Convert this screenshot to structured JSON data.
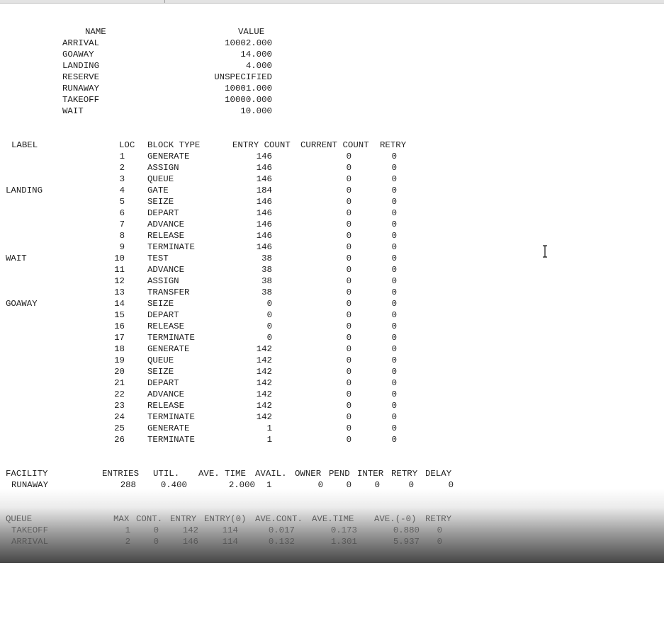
{
  "symbols": {
    "header": {
      "name": "NAME",
      "value": "VALUE"
    },
    "rows": [
      {
        "name": "ARRIVAL",
        "value": "10002.000"
      },
      {
        "name": "GOAWAY",
        "value": "14.000"
      },
      {
        "name": "LANDING",
        "value": "4.000"
      },
      {
        "name": "RESERVE",
        "value": "UNSPECIFIED"
      },
      {
        "name": "RUNAWAY",
        "value": "10001.000"
      },
      {
        "name": "TAKEOFF",
        "value": "10000.000"
      },
      {
        "name": "WAIT",
        "value": "10.000"
      }
    ]
  },
  "blocks": {
    "header": {
      "label": "LABEL",
      "loc": "LOC",
      "type": "BLOCK TYPE",
      "entry": "ENTRY COUNT",
      "current": "CURRENT COUNT",
      "retry": "RETRY"
    },
    "rows": [
      {
        "label": "",
        "loc": "1",
        "type": "GENERATE",
        "entry": "146",
        "current": "0",
        "retry": "0"
      },
      {
        "label": "",
        "loc": "2",
        "type": "ASSIGN",
        "entry": "146",
        "current": "0",
        "retry": "0"
      },
      {
        "label": "",
        "loc": "3",
        "type": "QUEUE",
        "entry": "146",
        "current": "0",
        "retry": "0"
      },
      {
        "label": "LANDING",
        "loc": "4",
        "type": "GATE",
        "entry": "184",
        "current": "0",
        "retry": "0"
      },
      {
        "label": "",
        "loc": "5",
        "type": "SEIZE",
        "entry": "146",
        "current": "0",
        "retry": "0"
      },
      {
        "label": "",
        "loc": "6",
        "type": "DEPART",
        "entry": "146",
        "current": "0",
        "retry": "0"
      },
      {
        "label": "",
        "loc": "7",
        "type": "ADVANCE",
        "entry": "146",
        "current": "0",
        "retry": "0"
      },
      {
        "label": "",
        "loc": "8",
        "type": "RELEASE",
        "entry": "146",
        "current": "0",
        "retry": "0"
      },
      {
        "label": "",
        "loc": "9",
        "type": "TERMINATE",
        "entry": "146",
        "current": "0",
        "retry": "0"
      },
      {
        "label": "WAIT",
        "loc": "10",
        "type": "TEST",
        "entry": "38",
        "current": "0",
        "retry": "0"
      },
      {
        "label": "",
        "loc": "11",
        "type": "ADVANCE",
        "entry": "38",
        "current": "0",
        "retry": "0"
      },
      {
        "label": "",
        "loc": "12",
        "type": "ASSIGN",
        "entry": "38",
        "current": "0",
        "retry": "0"
      },
      {
        "label": "",
        "loc": "13",
        "type": "TRANSFER",
        "entry": "38",
        "current": "0",
        "retry": "0"
      },
      {
        "label": "GOAWAY",
        "loc": "14",
        "type": "SEIZE",
        "entry": "0",
        "current": "0",
        "retry": "0"
      },
      {
        "label": "",
        "loc": "15",
        "type": "DEPART",
        "entry": "0",
        "current": "0",
        "retry": "0"
      },
      {
        "label": "",
        "loc": "16",
        "type": "RELEASE",
        "entry": "0",
        "current": "0",
        "retry": "0"
      },
      {
        "label": "",
        "loc": "17",
        "type": "TERMINATE",
        "entry": "0",
        "current": "0",
        "retry": "0"
      },
      {
        "label": "",
        "loc": "18",
        "type": "GENERATE",
        "entry": "142",
        "current": "0",
        "retry": "0"
      },
      {
        "label": "",
        "loc": "19",
        "type": "QUEUE",
        "entry": "142",
        "current": "0",
        "retry": "0"
      },
      {
        "label": "",
        "loc": "20",
        "type": "SEIZE",
        "entry": "142",
        "current": "0",
        "retry": "0"
      },
      {
        "label": "",
        "loc": "21",
        "type": "DEPART",
        "entry": "142",
        "current": "0",
        "retry": "0"
      },
      {
        "label": "",
        "loc": "22",
        "type": "ADVANCE",
        "entry": "142",
        "current": "0",
        "retry": "0"
      },
      {
        "label": "",
        "loc": "23",
        "type": "RELEASE",
        "entry": "142",
        "current": "0",
        "retry": "0"
      },
      {
        "label": "",
        "loc": "24",
        "type": "TERMINATE",
        "entry": "142",
        "current": "0",
        "retry": "0"
      },
      {
        "label": "",
        "loc": "25",
        "type": "GENERATE",
        "entry": "1",
        "current": "0",
        "retry": "0"
      },
      {
        "label": "",
        "loc": "26",
        "type": "TERMINATE",
        "entry": "1",
        "current": "0",
        "retry": "0"
      }
    ]
  },
  "facility": {
    "header": {
      "facility": "FACILITY",
      "entries": "ENTRIES",
      "util": "UTIL.",
      "avetime": "AVE. TIME",
      "avail": "AVAIL.",
      "owner": "OWNER",
      "pend": "PEND",
      "inter": "INTER",
      "retry": "RETRY",
      "delay": "DELAY"
    },
    "rows": [
      {
        "facility": "RUNAWAY",
        "entries": "288",
        "util": "0.400",
        "avetime": "2.000",
        "avail": "1",
        "owner": "0",
        "pend": "0",
        "inter": "0",
        "retry": "0",
        "delay": "0"
      }
    ]
  },
  "queue": {
    "header": {
      "queue": "QUEUE",
      "max": "MAX",
      "cont": "CONT.",
      "entry": "ENTRY",
      "entry0": "ENTRY(0)",
      "avecont": "AVE.CONT.",
      "avetime": "AVE.TIME",
      "ave0": "AVE.(-0)",
      "retry": "RETRY"
    },
    "rows": [
      {
        "queue": "TAKEOFF",
        "max": "1",
        "cont": "0",
        "entry": "142",
        "entry0": "114",
        "avecont": "0.017",
        "avetime": "0.173",
        "ave0": "0.880",
        "retry": "0"
      },
      {
        "queue": "ARRIVAL",
        "max": "2",
        "cont": "0",
        "entry": "146",
        "entry0": "114",
        "avecont": "0.132",
        "avetime": "1.301",
        "ave0": "5.937",
        "retry": "0"
      }
    ]
  },
  "cursor_icon": "text-ibeam-cursor-icon"
}
